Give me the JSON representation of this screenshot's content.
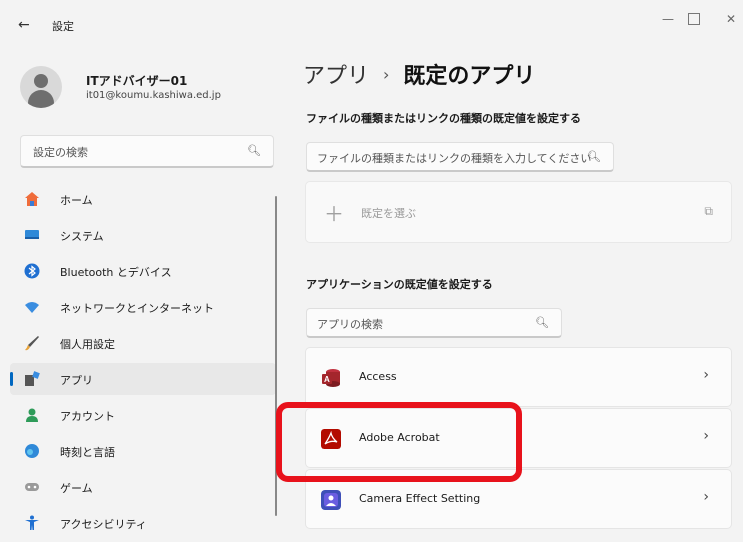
{
  "window": {
    "title": "設定",
    "back_icon": "arrow-left-icon"
  },
  "profile": {
    "name": "ITアドバイザー01",
    "email": "it01@koumu.kashiwa.ed.jp"
  },
  "left_search": {
    "placeholder": "設定の検索"
  },
  "nav": {
    "items": [
      {
        "label": "ホーム",
        "icon": "home-icon"
      },
      {
        "label": "システム",
        "icon": "system-icon"
      },
      {
        "label": "Bluetooth とデバイス",
        "icon": "bluetooth-icon"
      },
      {
        "label": "ネットワークとインターネット",
        "icon": "network-icon"
      },
      {
        "label": "個人用設定",
        "icon": "brush-icon"
      },
      {
        "label": "アプリ",
        "icon": "apps-icon",
        "selected": true
      },
      {
        "label": "アカウント",
        "icon": "account-icon"
      },
      {
        "label": "時刻と言語",
        "icon": "time-language-icon"
      },
      {
        "label": "ゲーム",
        "icon": "gaming-icon"
      },
      {
        "label": "アクセシビリティ",
        "icon": "accessibility-icon"
      }
    ]
  },
  "breadcrumb": {
    "parent": "アプリ",
    "separator": "›",
    "current": "既定のアプリ"
  },
  "file_section": {
    "heading": "ファイルの種類またはリンクの種類の既定値を設定する",
    "placeholder": "ファイルの種類またはリンクの種類を入力してください",
    "choose_label": "既定を選ぶ"
  },
  "app_section": {
    "heading": "アプリケーションの既定値を設定する",
    "search_placeholder": "アプリの検索",
    "apps": [
      {
        "label": "Access",
        "icon": "access-icon"
      },
      {
        "label": "Adobe Acrobat",
        "icon": "adobe-acrobat-icon"
      },
      {
        "label": "Camera Effect Setting",
        "icon": "camera-effect-icon"
      }
    ]
  },
  "colors": {
    "accent": "#0067c0",
    "highlight": "#e8121b",
    "background": "#f3f3f3"
  }
}
